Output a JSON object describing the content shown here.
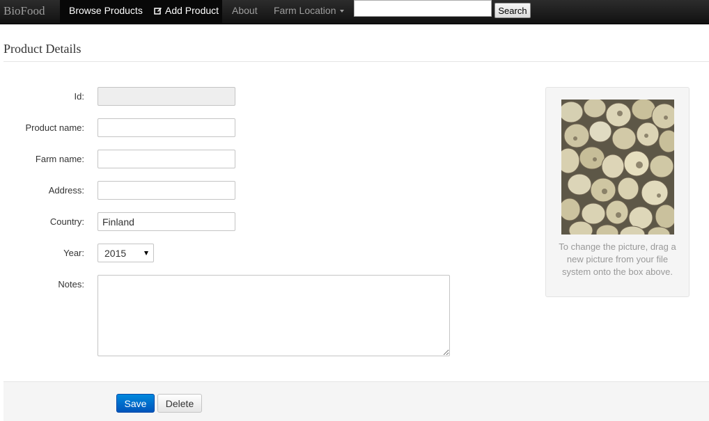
{
  "navbar": {
    "brand": "BioFood",
    "items": [
      {
        "label": "Browse Products",
        "active": true
      },
      {
        "label": "Add Product",
        "icon": "edit-icon",
        "active": true
      },
      {
        "label": "About"
      },
      {
        "label": "Farm Location",
        "icon": "caret-down-icon"
      }
    ],
    "search": {
      "value": "",
      "button_label": "Search"
    }
  },
  "page": {
    "title": "Product Details"
  },
  "form": {
    "id": {
      "label": "Id:",
      "value": ""
    },
    "product_name": {
      "label": "Product name:",
      "value": ""
    },
    "farm_name": {
      "label": "Farm name:",
      "value": ""
    },
    "address": {
      "label": "Address:",
      "value": ""
    },
    "country": {
      "label": "Country:",
      "value": "Finland"
    },
    "year": {
      "label": "Year:",
      "value": "2015"
    },
    "notes": {
      "label": "Notes:",
      "value": ""
    }
  },
  "picture": {
    "subject": "potatoes",
    "caption": "To change the picture, drag a new picture from your file system onto the box above."
  },
  "actions": {
    "save_label": "Save",
    "delete_label": "Delete"
  },
  "colors": {
    "navbar": "#1b1b1b",
    "primary_button": "#0066cc",
    "panel_bg": "#f5f5f5"
  }
}
